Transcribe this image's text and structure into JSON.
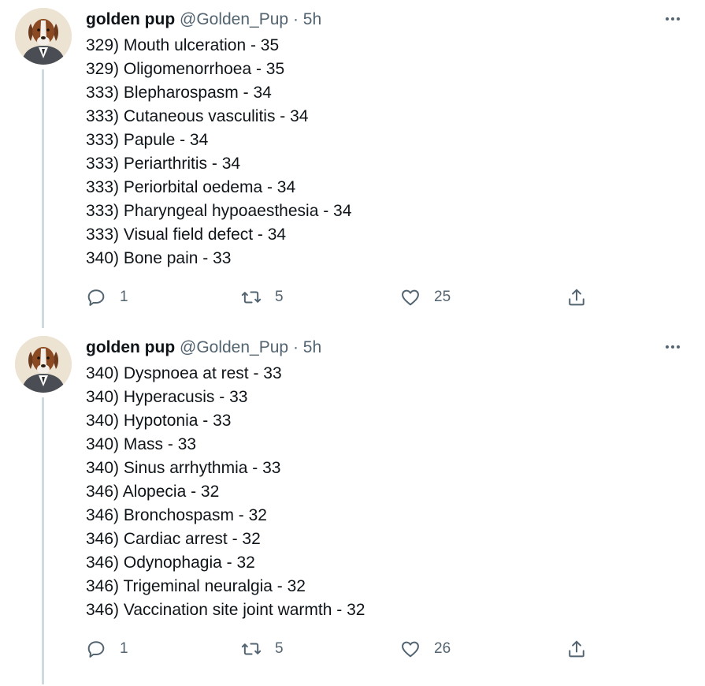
{
  "tweets": [
    {
      "author_name": "golden pup",
      "handle": "@Golden_Pup",
      "separator": "·",
      "time": "5h",
      "lines": [
        "329) Mouth ulceration - 35",
        "329) Oligomenorrhoea - 35",
        "333) Blepharospasm - 34",
        "333) Cutaneous vasculitis - 34",
        "333) Papule - 34",
        "333) Periarthritis - 34",
        "333) Periorbital oedema - 34",
        "333) Pharyngeal hypoaesthesia - 34",
        "333) Visual field defect - 34",
        "340) Bone pain - 33"
      ],
      "actions": {
        "replies": "1",
        "retweets": "5",
        "likes": "25"
      }
    },
    {
      "author_name": "golden pup",
      "handle": "@Golden_Pup",
      "separator": "·",
      "time": "5h",
      "lines": [
        "340) Dyspnoea at rest - 33",
        "340) Hyperacusis - 33",
        "340) Hypotonia - 33",
        "340) Mass - 33",
        "340) Sinus arrhythmia - 33",
        "346) Alopecia - 32",
        "346) Bronchospasm - 32",
        "346) Cardiac arrest - 32",
        "346) Odynophagia - 32",
        "346) Trigeminal neuralgia - 32",
        "346) Vaccination site joint warmth - 32"
      ],
      "actions": {
        "replies": "1",
        "retweets": "5",
        "likes": "26"
      }
    }
  ],
  "icons": {
    "avatar": "dog-avatar-icon",
    "more": "more-dots-icon",
    "reply": "reply-bubble-icon",
    "retweet": "retweet-icon",
    "like": "heart-icon",
    "share": "share-upload-icon"
  },
  "colors": {
    "text": "#0f1419",
    "secondary": "#536471",
    "thread_line": "#cfd9de",
    "background": "#ffffff"
  }
}
